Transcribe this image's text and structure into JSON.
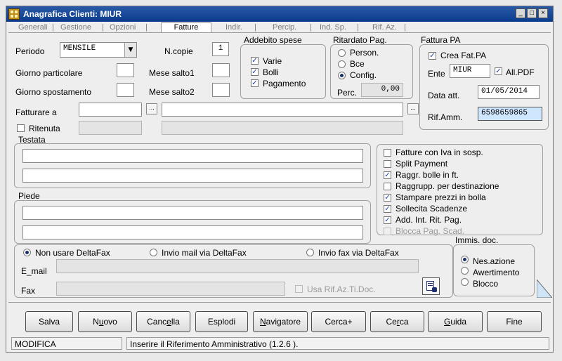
{
  "window": {
    "title": "Anagrafica Clienti: MIUR",
    "minimize": "_",
    "maximize": "□",
    "close": "×"
  },
  "tabs": [
    {
      "label": "Generali"
    },
    {
      "label": "Gestione"
    },
    {
      "label": "Opzioni"
    },
    {
      "label": "Fatture"
    },
    {
      "label": "Indir."
    },
    {
      "label": "Percip."
    },
    {
      "label": "Ind. Sp."
    },
    {
      "label": "Rif. Az."
    }
  ],
  "tab_separator": "|",
  "form": {
    "periodo_label": "Periodo",
    "periodo_value": "MENSILE",
    "ncopie_label": "N.copie",
    "ncopie_value": "1",
    "giorno_particolare_label": "Giorno particolare",
    "mese_salto1_label": "Mese salto1",
    "giorno_spostamento_label": "Giorno spostamento",
    "mese_salto2_label": "Mese salto2",
    "fatturare_a_label": "Fatturare a",
    "ritenuta_label": "Ritenuta",
    "ellipsis": "..."
  },
  "addebito": {
    "title": "Addebito spese",
    "items": [
      {
        "label": "Varie",
        "checked": true
      },
      {
        "label": "Bolli",
        "checked": true
      },
      {
        "label": "Pagamento",
        "checked": true
      }
    ]
  },
  "ritardato": {
    "title": "Ritardato Pag.",
    "options": [
      {
        "label": "Person.",
        "selected": false
      },
      {
        "label": "Bce",
        "selected": false
      },
      {
        "label": "Config.",
        "selected": true
      }
    ],
    "perc_label": "Perc.",
    "perc_value": "0,00"
  },
  "fattura_pa": {
    "title": "Fattura PA",
    "crea_label": "Crea Fat.PA",
    "crea_checked": true,
    "ente_label": "Ente",
    "ente_value": "MIUR",
    "allpdf_label": "All.PDF",
    "allpdf_checked": true,
    "data_label": "Data att.",
    "data_value": "01/05/2014",
    "rif_label": "Rif.Amm.",
    "rif_value": "6598659865"
  },
  "testata_label": "Testata",
  "piede_label": "Piede",
  "options": [
    {
      "label": "Fatture con Iva in sosp.",
      "checked": false,
      "disabled": false
    },
    {
      "label": "Split Payment",
      "checked": false,
      "disabled": false
    },
    {
      "label": "Raggr. bolle in ft.",
      "checked": true,
      "disabled": false
    },
    {
      "label": "Raggrupp. per destinazione",
      "checked": false,
      "disabled": false
    },
    {
      "label": "Stampare prezzi in bolla",
      "checked": true,
      "disabled": false
    },
    {
      "label": "Sollecita Scadenze",
      "checked": true,
      "disabled": false
    },
    {
      "label": "Add. Int. Rit. Pag.",
      "checked": true,
      "disabled": false
    },
    {
      "label": "Blocca Pag. Scad.",
      "checked": false,
      "disabled": true
    }
  ],
  "deltafax": {
    "options": [
      {
        "label": "Non usare DeltaFax",
        "selected": true
      },
      {
        "label": "Invio mail via DeltaFax",
        "selected": false
      },
      {
        "label": "Invio fax via DeltaFax",
        "selected": false
      }
    ],
    "email_label": "E_mail",
    "fax_label": "Fax",
    "usa_rif_label": "Usa Rif.Az.Ti.Doc."
  },
  "immis": {
    "title": "Immis. doc.",
    "options": [
      {
        "label": "Nes.azione",
        "selected": true
      },
      {
        "label": "Awertimento",
        "selected": false
      },
      {
        "label": "Blocco",
        "selected": false
      }
    ]
  },
  "buttons": [
    {
      "pre": "Salva",
      "u": "",
      "post": ""
    },
    {
      "pre": "N",
      "u": "u",
      "post": "ovo"
    },
    {
      "pre": "Canc",
      "u": "e",
      "post": "lla"
    },
    {
      "pre": "Esplodi",
      "u": "",
      "post": ""
    },
    {
      "pre": "",
      "u": "N",
      "post": "avigatore"
    },
    {
      "pre": "Cerca+",
      "u": "",
      "post": ""
    },
    {
      "pre": "Ce",
      "u": "r",
      "post": "ca"
    },
    {
      "pre": "",
      "u": "G",
      "post": "uida"
    },
    {
      "pre": "Fine",
      "u": "",
      "post": ""
    }
  ],
  "status": {
    "mode": "MODIFICA",
    "message": "Inserire il Riferimento Amministrativo (1.2.6 )."
  },
  "colors": {
    "title_bar": "#0a3a8c",
    "highlight_field": "#cfe6ff"
  },
  "icons": {
    "check": "✓",
    "dropdown": "▼",
    "attach": "document-icon"
  }
}
